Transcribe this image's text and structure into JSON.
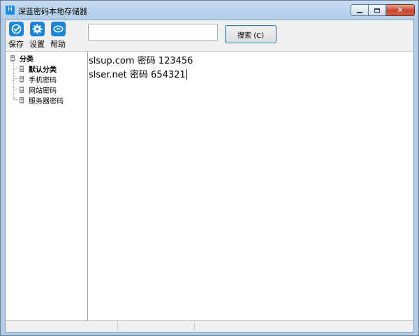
{
  "window": {
    "title": "深蓝密码本地存储器",
    "app_icon_glyph": "H"
  },
  "toolbar": {
    "save_label": "保存",
    "settings_label": "设置",
    "help_label": "帮助",
    "search_placeholder": "",
    "search_value": "",
    "search_button_label": "搜索 (C)"
  },
  "tree": {
    "root_label": "分类",
    "items": [
      {
        "label": "默认分类"
      },
      {
        "label": "手机密码"
      },
      {
        "label": "网站密码"
      },
      {
        "label": "服务器密码"
      }
    ]
  },
  "editor": {
    "lines": [
      "slsup.com 密码 123456",
      "slser.net 密码 654321"
    ]
  },
  "colors": {
    "accent": "#1a86d9",
    "close_button": "#c8452c"
  }
}
